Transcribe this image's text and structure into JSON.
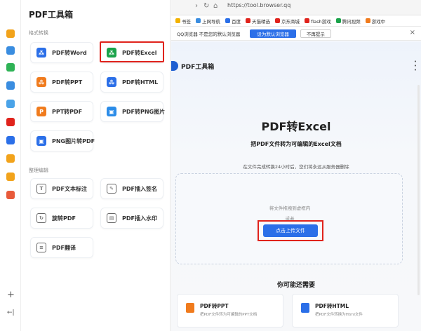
{
  "panel": {
    "title": "PDF工具箱",
    "section_convert": "格式转换",
    "section_edit": "整理编辑"
  },
  "tools_convert": [
    {
      "label": "PDF转Word",
      "icon": "pdf-icon",
      "color": "#2b6fe8",
      "glyph": "⁂"
    },
    {
      "label": "PDF转Excel",
      "icon": "pdf-icon",
      "color": "#1aa34a",
      "glyph": "⁂"
    },
    {
      "label": "PDF转PPT",
      "icon": "pdf-icon",
      "color": "#f07b1d",
      "glyph": "⁂"
    },
    {
      "label": "PDF转HTML",
      "icon": "pdf-icon",
      "color": "#2b6fe8",
      "glyph": "⁂"
    },
    {
      "label": "PPT转PDF",
      "icon": "ppt-icon",
      "color": "#f07b1d",
      "glyph": "P"
    },
    {
      "label": "PDF转PNG图片",
      "icon": "image-icon",
      "color": "#2b8ce8",
      "glyph": "▣"
    },
    {
      "label": "PNG图片转PDF",
      "icon": "image-icon",
      "color": "#2b6fe8",
      "glyph": "▣"
    }
  ],
  "tools_edit": [
    {
      "label": "PDF文本标注",
      "icon": "text-annotate-icon",
      "glyph": "T"
    },
    {
      "label": "PDF插入签名",
      "icon": "signature-icon",
      "glyph": "✎"
    },
    {
      "label": "旋转PDF",
      "icon": "rotate-icon",
      "glyph": "↻"
    },
    {
      "label": "PDF插入水印",
      "icon": "watermark-icon",
      "glyph": "▤"
    },
    {
      "label": "PDF翻译",
      "icon": "translate-icon",
      "glyph": "≡"
    }
  ],
  "browser": {
    "url": "https://tool.browser.qq",
    "bookmarks": [
      {
        "label": "书签",
        "icon": "star-icon",
        "color": "#f2b200"
      },
      {
        "label": "上网导航",
        "icon": "nav-icon",
        "color": "#3a8de0"
      },
      {
        "label": "百度",
        "icon": "baidu-icon",
        "color": "#2b6fe8"
      },
      {
        "label": "天猫精选",
        "icon": "tmall-icon",
        "color": "#e0231c"
      },
      {
        "label": "京东商城",
        "icon": "jd-icon",
        "color": "#e0231c"
      },
      {
        "label": "flash游戏",
        "icon": "flash-icon",
        "color": "#e0231c"
      },
      {
        "label": "腾讯视频",
        "icon": "video-icon",
        "color": "#1aa34a"
      },
      {
        "label": "游戏中",
        "icon": "game-icon",
        "color": "#f07b1d"
      }
    ],
    "notice_text": "QQ浏览器 不是您的默认浏览器",
    "set_default": "设为默认浏览器",
    "no_remind": "不再提示"
  },
  "page": {
    "logo_text": "PDF工具箱",
    "title": "PDF转Excel",
    "subtitle": "把PDF文件转为可编辑的Excel文档",
    "note": "在文件完成转换24小时后，您们将永远从服务器删除",
    "drop_hint": "将文件拖拽到虚框内",
    "drop_or": "或者",
    "upload_label": "点击上传文件",
    "need_title": "你可能还需要",
    "suggestions": [
      {
        "name": "PDF转PPT",
        "desc": "把PDF文件转为可编辑的PPT文档",
        "color": "#f07b1d"
      },
      {
        "name": "PDF转HTML",
        "desc": "把PDF文件转换为Html文件",
        "color": "#2b6fe8"
      }
    ]
  },
  "rail": {
    "add": "+",
    "collapse": "←|"
  }
}
